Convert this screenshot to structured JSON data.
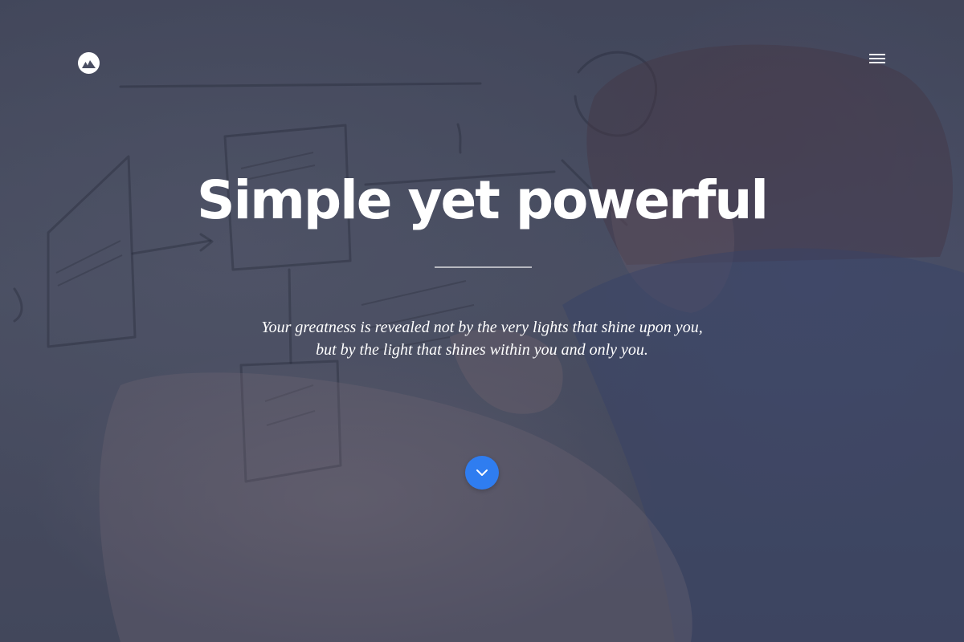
{
  "brand": {
    "logo_icon": "mountain-icon",
    "logo_bg": "#ffffff"
  },
  "nav": {
    "menu_icon": "hamburger-menu-icon"
  },
  "hero": {
    "headline": "Simple yet powerful",
    "quote_line_1": "Your greatness is revealed not by the very lights that shine upon you,",
    "quote_line_2": "but by the light that shines within you and only you.",
    "scroll_icon": "chevron-down-icon",
    "scroll_button_color": "#2f7df0",
    "overlay_color": "#4a4e62"
  }
}
